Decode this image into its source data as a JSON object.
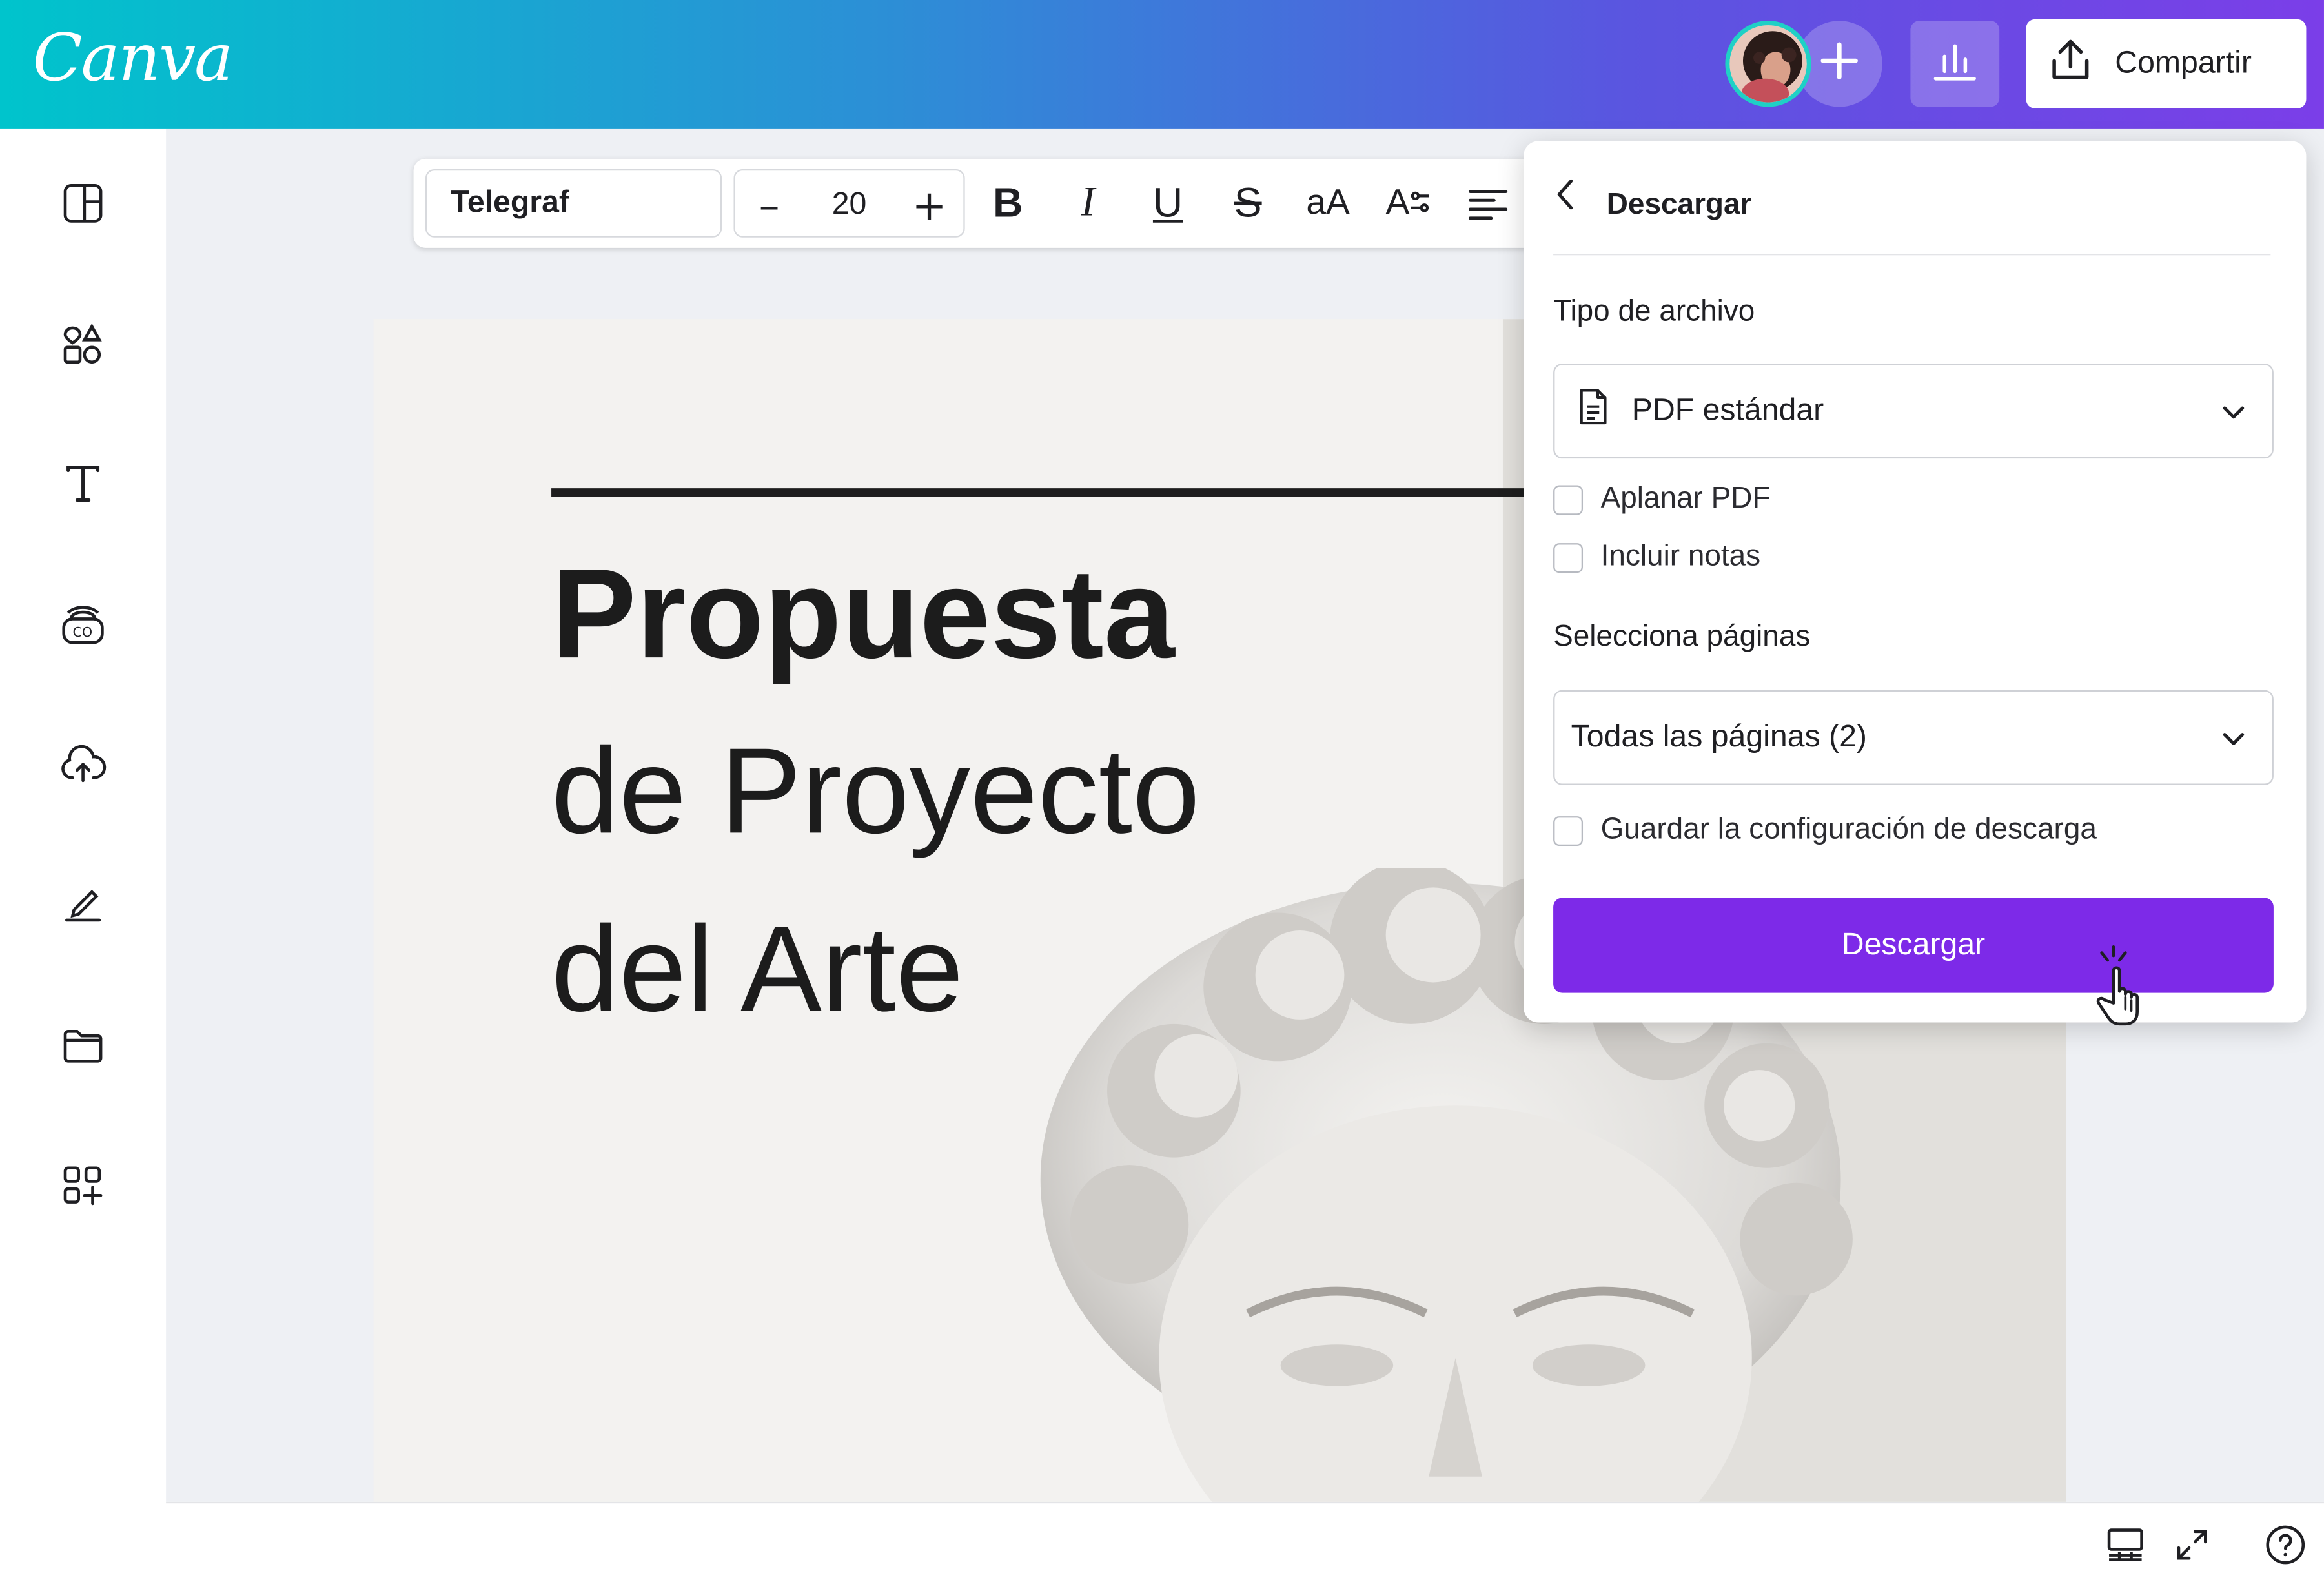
{
  "app": {
    "logo": "Canva"
  },
  "header": {
    "share_label": "Compartir",
    "avatar_icon": "user-avatar",
    "add_icon": "plus-icon",
    "insights_icon": "bar-chart-icon",
    "share_icon": "upload-share-icon"
  },
  "sidebar": {
    "items": [
      {
        "icon": "layout-templates-icon"
      },
      {
        "icon": "elements-icon"
      },
      {
        "icon": "text-icon"
      },
      {
        "icon": "brand-icon"
      },
      {
        "icon": "upload-cloud-icon"
      },
      {
        "icon": "draw-icon"
      },
      {
        "icon": "projects-folder-icon"
      },
      {
        "icon": "apps-icon"
      }
    ]
  },
  "toolbar": {
    "font": "Telegraf",
    "font_size": "20",
    "minus": "–",
    "plus": "+",
    "bold": "B",
    "italic": "I",
    "underline": "U",
    "strike": "S",
    "case": "aA",
    "spacing": "A"
  },
  "design": {
    "line1": "Propuesta",
    "line2": "de Proyecto",
    "line3": "del Arte"
  },
  "download_panel": {
    "title": "Descargar",
    "file_type_label": "Tipo de archivo",
    "file_type_value": "PDF estándar",
    "flatten_label": "Aplanar PDF",
    "flatten_checked": false,
    "notes_label": "Incluir notas",
    "notes_checked": false,
    "pages_label": "Selecciona páginas",
    "pages_value": "Todas las páginas (2)",
    "save_settings_label": "Guardar la configuración de descarga",
    "save_settings_checked": false,
    "button_label": "Descargar"
  },
  "colors": {
    "accent": "#7d2ae8",
    "header_gradient_start": "#00c4cc",
    "header_gradient_end": "#7b3ee8"
  }
}
